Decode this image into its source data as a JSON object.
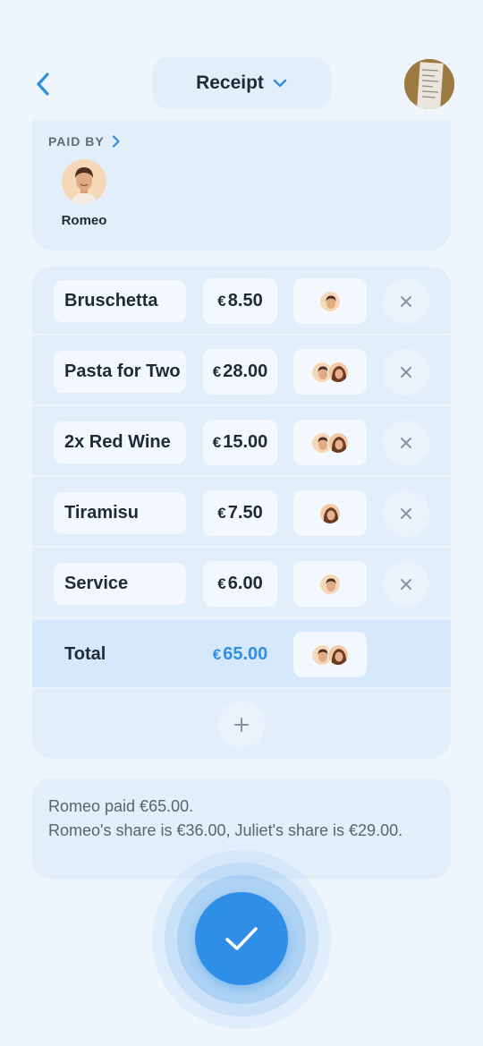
{
  "header": {
    "title": "Receipt",
    "icons": {
      "back": "chevron-left-icon",
      "dropdown": "chevron-down-icon",
      "thumbnail": "receipt-photo"
    }
  },
  "paid_by": {
    "label": "PAID BY",
    "payer": {
      "name": "Romeo",
      "avatar": "male-avatar"
    }
  },
  "items": [
    {
      "name": "Bruschetta",
      "currency": "€",
      "amount": "8.50",
      "people": [
        "romeo"
      ]
    },
    {
      "name": "Pasta for Two",
      "currency": "€",
      "amount": "28.00",
      "people": [
        "romeo",
        "juliet"
      ]
    },
    {
      "name": "2x Red Wine",
      "currency": "€",
      "amount": "15.00",
      "people": [
        "romeo",
        "juliet"
      ]
    },
    {
      "name": "Tiramisu",
      "currency": "€",
      "amount": "7.50",
      "people": [
        "juliet"
      ]
    },
    {
      "name": "Service",
      "currency": "€",
      "amount": "6.00",
      "people": [
        "romeo"
      ]
    }
  ],
  "total": {
    "label": "Total",
    "currency": "€",
    "amount": "65.00",
    "people": [
      "romeo",
      "juliet"
    ]
  },
  "summary": {
    "line1": "Romeo paid €65.00.",
    "line2": "Romeo's share is €36.00, Juliet's share is €29.00."
  },
  "colors": {
    "accent": "#2f8ee5",
    "background": "#eef5fd",
    "card": "#e3eefb",
    "text": "#1f2a37"
  }
}
